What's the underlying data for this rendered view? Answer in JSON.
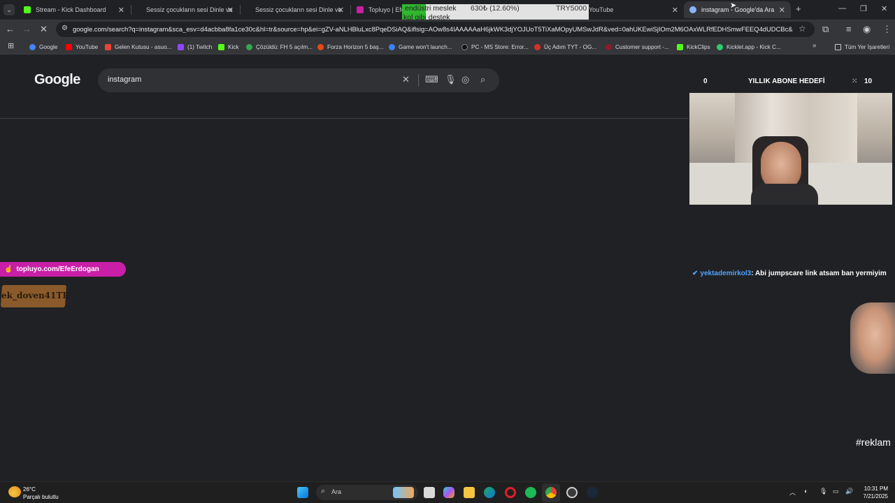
{
  "browser": {
    "tabs": [
      {
        "title": "Stream - Kick Dashboard",
        "color": "#53fc18",
        "active": false
      },
      {
        "title": "Sessiz çocukların sesi Dinle ve",
        "color": "#5a5a5a",
        "active": false
      },
      {
        "title": "Sessiz çocukların sesi Dinle ve",
        "color": "#5a5a5a",
        "active": false
      },
      {
        "title": "Topluyo | EfeE",
        "color": "#c81fa6",
        "active": false
      },
      {
        "title": "YouTube",
        "color": "#ff0000",
        "active": false
      },
      {
        "title": "instagram - Google'da Ara",
        "color": "#8ab4f8",
        "active": true
      }
    ],
    "url": "google.com/search?q=instagram&sca_esv=d4acbba8fa1ce30c&hl=tr&source=hp&ei=gZV-aNLHBluLxc8PqeDSiAQ&iflsig=AOw8s4IAAAAAaH6jkWK3djYOJUoT5TiXaMOpyUMSwJdR&ved=0ahUKEwiSjIOm2M6OAxWLRfEDHSmwFEEQ4dUDCBc&uact...",
    "bookmarks": [
      {
        "label": "Google",
        "color": "#4285f4"
      },
      {
        "label": "YouTube",
        "color": "#ff0000"
      },
      {
        "label": "Gelen Kutusu - asuo...",
        "color": "#ea4335"
      },
      {
        "label": "(1) Twitch",
        "color": "#9146ff"
      },
      {
        "label": "Kick",
        "color": "#53fc18"
      },
      {
        "label": "Çözüldü: FH 5 açılm...",
        "color": "#34a853"
      },
      {
        "label": "Forza Horizon 5 baş...",
        "color": "#e64a19"
      },
      {
        "label": "Game won't launch...",
        "color": "#3b82f6"
      },
      {
        "label": "PC - MS Store: Error...",
        "color": "#111111"
      },
      {
        "label": "Üç Adım TYT - OG...",
        "color": "#d93025"
      },
      {
        "label": "Customer support -...",
        "color": "#8b1d2c"
      },
      {
        "label": "KickClips",
        "color": "#53fc18"
      },
      {
        "label": "Kicklet.app - Kick C...",
        "color": "#2ecc71"
      }
    ],
    "bookmarks_folder": "Tüm Yer İşaretleri"
  },
  "google": {
    "logo": "Google",
    "query": "instagram"
  },
  "overlays": {
    "banner_line1": "endüstri meslek",
    "banner_line2": "kol gibi destek",
    "banner_amount": "630₺ (12.60%)",
    "banner_goal": "TRY5000",
    "sub_goal_current": "0",
    "sub_goal_label": "YILLIK ABONE HEDEFİ",
    "sub_goal_target": "10",
    "promo_link": "topluyo.com/EfeErdogan",
    "sign_text": "ek_doven41TR",
    "chat_user": "yektademirkol3",
    "chat_text": ": Abi jumpscare link atsam ban yermiyim",
    "hashtag": "#reklam"
  },
  "taskbar": {
    "weather_temp": "26°C",
    "weather_desc": "Parçalı bulutlu",
    "search_label": "Ara",
    "time": "10:31 PM",
    "date": "7/21/2025"
  }
}
